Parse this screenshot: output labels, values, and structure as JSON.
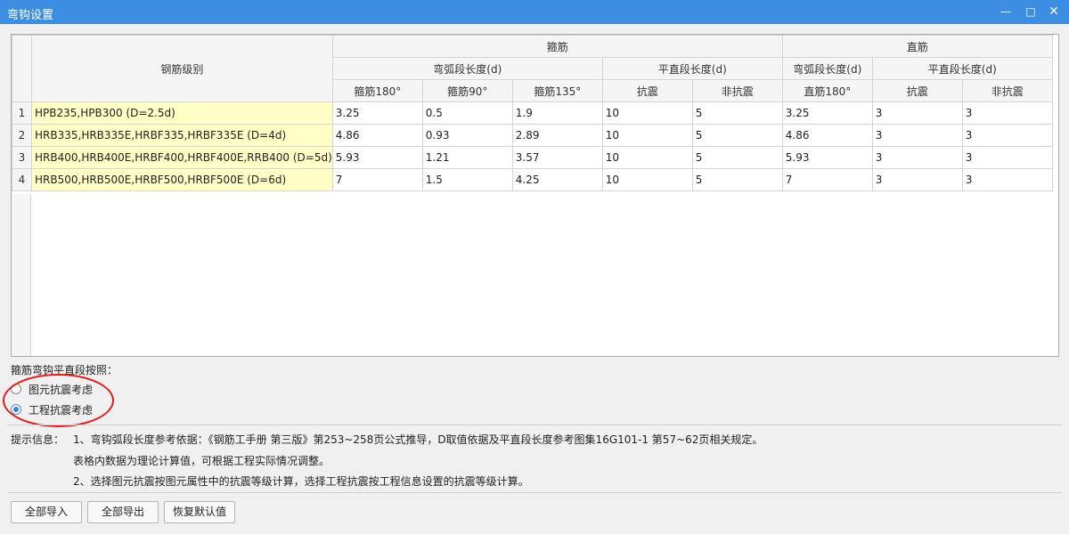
{
  "window": {
    "title": "弯钩设置",
    "min_icon": "—",
    "max_icon": "□",
    "close_icon": "✕"
  },
  "table": {
    "header": {
      "grade": "钢筋级别",
      "stirrup": "箍筋",
      "straight": "直筋",
      "arc_length": "弯弧段长度(d)",
      "flat_length": "平直段长度(d)",
      "s180": "箍筋180°",
      "s90": "箍筋90°",
      "s135": "箍筋135°",
      "seismic": "抗震",
      "nonseismic": "非抗震",
      "straight_arc": "弯弧段长度(d)",
      "straight_flat": "平直段长度(d)",
      "d180": "直筋180°",
      "straight_seismic": "抗震",
      "straight_nonseismic": "非抗震"
    },
    "rows": [
      [
        "1",
        "HPB235,HPB300 (D=2.5d)",
        "3.25",
        "0.5",
        "1.9",
        "10",
        "5",
        "3.25",
        "3",
        "3"
      ],
      [
        "2",
        "HRB335,HRB335E,HRBF335,HRBF335E (D=4d)",
        "4.86",
        "0.93",
        "2.89",
        "10",
        "5",
        "4.86",
        "3",
        "3"
      ],
      [
        "3",
        "HRB400,HRB400E,HRBF400,HRBF400E,RRB400 (D=5d)",
        "5.93",
        "1.21",
        "3.57",
        "10",
        "5",
        "5.93",
        "3",
        "3"
      ],
      [
        "4",
        "HRB500,HRB500E,HRBF500,HRBF500E (D=6d)",
        "7",
        "1.5",
        "4.25",
        "10",
        "5",
        "7",
        "3",
        "3"
      ]
    ]
  },
  "options": {
    "label": "箍筋弯钩平直段按照：",
    "radio1": "图元抗震考虑",
    "radio2": "工程抗震考虑",
    "selected": "radio2"
  },
  "hints": {
    "label": "提示信息：",
    "line1": "1、弯钩弧段长度参考依据：《钢筋工手册 第三版》第253~258页公式推导，D取值依据及平直段长度参考图集16G101-1 第57~62页相关规定。",
    "line2": "表格内数据为理论计算值，可根据工程实际情况调整。",
    "line3": "2、选择图元抗震按图元属性中的抗震等级计算，选择工程抗震按工程信息设置的抗震等级计算。"
  },
  "buttons": {
    "import_all": "全部导入",
    "export_all": "全部导出",
    "restore_default": "恢复默认值"
  }
}
